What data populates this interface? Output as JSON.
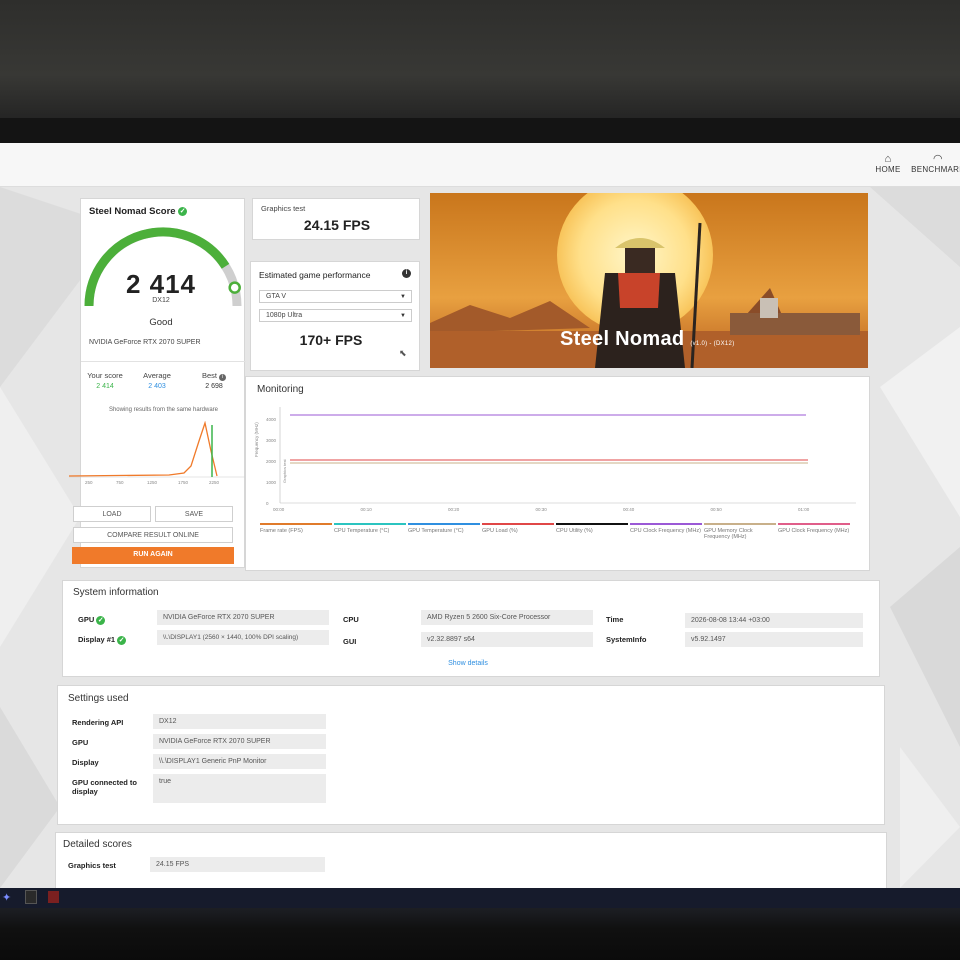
{
  "nav": {
    "home": "HOME",
    "benchmarks": "BENCHMARK",
    "home_icon": "home-icon",
    "bench_icon": "gauge-icon"
  },
  "score_card": {
    "title": "Steel Nomad Score",
    "score": "2 414",
    "api": "DX12",
    "rating": "Good",
    "gpu": "NVIDIA GeForce RTX 2070 SUPER",
    "gauge_fraction": 0.82,
    "your_score_label": "Your score",
    "your_score": "2 414",
    "average_label": "Average",
    "average": "2 403",
    "best_label": "Best",
    "best": "2 698",
    "hardware_note": "Showing results from the same hardware",
    "hist_ticks": [
      "250",
      "750",
      "1250",
      "1750",
      "2250"
    ],
    "load_label": "LOAD",
    "save_label": "SAVE",
    "compare_label": "COMPARE RESULT ONLINE",
    "run_again_label": "RUN AGAIN",
    "accent": "#3bb44a",
    "orange": "#f07a2a"
  },
  "graphics_test": {
    "label": "Graphics test",
    "value": "24.15 FPS"
  },
  "estimated": {
    "title": "Estimated game performance",
    "game": "GTA V",
    "preset": "1080p Ultra",
    "fps": "170+ FPS"
  },
  "banner": {
    "title": "Steel Nomad",
    "sub": "(v1.0) - (DX12)"
  },
  "monitoring": {
    "title": "Monitoring",
    "y_label": "Frequency (MHz)",
    "y_label2": "Graphics test",
    "y_ticks": [
      "4000",
      "3000",
      "2000",
      "1000",
      "0"
    ],
    "x_ticks": [
      "00:00",
      "00:10",
      "00:20",
      "00:30",
      "00:40",
      "00:50",
      "01:00"
    ],
    "legend": [
      {
        "name": "Frame rate (FPS)",
        "color": "#e07b2b"
      },
      {
        "name": "CPU Temperature (°C)",
        "color": "#2bc4c0"
      },
      {
        "name": "GPU Temperature (°C)",
        "color": "#2f8fe0"
      },
      {
        "name": "GPU Load (%)",
        "color": "#e04747"
      },
      {
        "name": "CPU Utility (%)",
        "color": "#111111"
      },
      {
        "name": "CPU Clock Frequency (MHz)",
        "color": "#9b59d6"
      },
      {
        "name": "GPU Memory Clock Frequency (MHz)",
        "color": "#c8b08a"
      },
      {
        "name": "GPU Clock Frequency (MHz)",
        "color": "#e05e8a"
      }
    ]
  },
  "system_info": {
    "title": "System information",
    "gpu_label": "GPU",
    "gpu": "NVIDIA GeForce RTX 2070 SUPER",
    "display_label": "Display #1",
    "display": "\\\\.\\DISPLAY1 (2560 × 1440, 100% DPI scaling)",
    "cpu_label": "CPU",
    "cpu": "AMD Ryzen 5 2600 Six-Core Processor",
    "gui_label": "GUI",
    "gui": "v2.32.8897 s64",
    "time_label": "Time",
    "time": "2026-08-08 13:44 +03:00",
    "sysinfo_label": "SystemInfo",
    "sysinfo": "v5.92.1497",
    "show_details": "Show details"
  },
  "settings": {
    "title": "Settings used",
    "rows": [
      {
        "label": "Rendering API",
        "value": "DX12"
      },
      {
        "label": "GPU",
        "value": "NVIDIA GeForce RTX 2070 SUPER"
      },
      {
        "label": "Display",
        "value": "\\\\.\\DISPLAY1 Generic PnP Monitor"
      },
      {
        "label": "GPU connected to display",
        "value": "true"
      }
    ]
  },
  "detailed": {
    "title": "Detailed scores",
    "graphics_label": "Graphics test",
    "graphics_value": "24.15 FPS"
  }
}
